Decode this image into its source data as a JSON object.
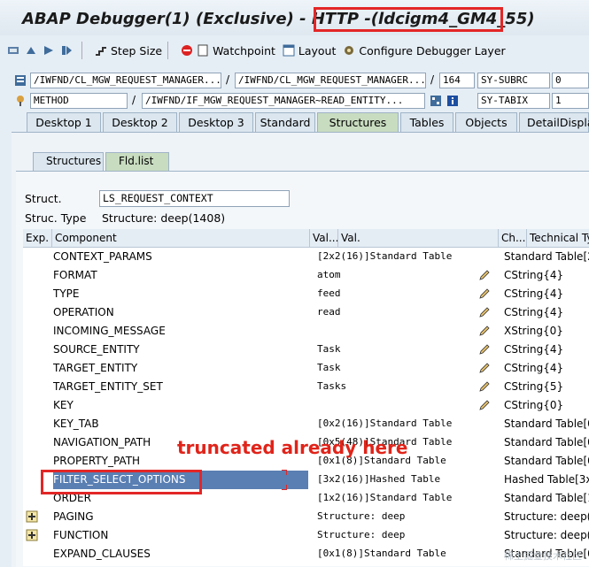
{
  "title": {
    "text": "ABAP Debugger(1)  (Exclusive) - HTTP ",
    "highlight": "-(ldcigm4_GM4_55)"
  },
  "toolbar": {
    "buttons": [
      {
        "label": "",
        "icon": "step-over-icon"
      },
      {
        "label": "",
        "icon": "step-out-icon"
      },
      {
        "label": "",
        "icon": "continue-icon"
      },
      {
        "label": "",
        "icon": "run-to-cursor-icon"
      },
      {
        "label": "Step Size",
        "icon": "step-size-icon"
      },
      {
        "label": "Watchpoint",
        "icon": "watchpoint-icon"
      },
      {
        "label": "Layout",
        "icon": "layout-icon"
      },
      {
        "label": "Configure Debugger Layer",
        "icon": "configure-layer-icon"
      }
    ]
  },
  "info1": {
    "program": "/IWFND/CL_MGW_REQUEST_MANAGER...",
    "include": "/IWFND/CL_MGW_REQUEST_MANAGER...",
    "line": "164",
    "sysvar": "SY-SUBRC",
    "sysval": "0"
  },
  "info2": {
    "type": "METHOD",
    "name": "/IWFND/IF_MGW_REQUEST_MANAGER~READ_ENTITY...",
    "sysvar": "SY-TABIX",
    "sysval": "1"
  },
  "tabs": [
    "Desktop 1",
    "Desktop 2",
    "Desktop 3",
    "Standard",
    "Structures",
    "Tables",
    "Objects",
    "DetailDisplay"
  ],
  "subtabs": [
    "Structures",
    "Fld.list"
  ],
  "struct_label": "Struct.",
  "struct_value": "LS_REQUEST_CONTEXT",
  "struct_type_label": "Struc. Type",
  "struct_type_value": "Structure: deep(1408)",
  "columns": [
    "Exp.",
    "Component",
    "Val...",
    "Val.",
    "Ch...",
    "Technical Type"
  ],
  "rows": [
    {
      "component": "CONTEXT_PARAMS",
      "val": "[2x2(16)]Standard Table",
      "pencil": false,
      "tech": "Standard Table[2"
    },
    {
      "component": "FORMAT",
      "val": "atom",
      "pencil": true,
      "tech": "CString{4}"
    },
    {
      "component": "TYPE",
      "val": "feed",
      "pencil": true,
      "tech": "CString{4}"
    },
    {
      "component": "OPERATION",
      "val": "read",
      "pencil": true,
      "tech": "CString{4}"
    },
    {
      "component": "INCOMING_MESSAGE",
      "val": "",
      "pencil": true,
      "tech": "XString{0}"
    },
    {
      "component": "SOURCE_ENTITY",
      "val": "Task",
      "pencil": true,
      "tech": "CString{4}"
    },
    {
      "component": "TARGET_ENTITY",
      "val": "Task",
      "pencil": true,
      "tech": "CString{4}"
    },
    {
      "component": "TARGET_ENTITY_SET",
      "val": "Tasks",
      "pencil": true,
      "tech": "CString{5}"
    },
    {
      "component": "KEY",
      "val": "",
      "pencil": true,
      "tech": "CString{0}"
    },
    {
      "component": "KEY_TAB",
      "val": "[0x2(16)]Standard Table",
      "pencil": false,
      "tech": "Standard Table[0"
    },
    {
      "component": "NAVIGATION_PATH",
      "val": "[0x5(48)]Standard Table",
      "pencil": false,
      "tech": "Standard Table[0"
    },
    {
      "component": "PROPERTY_PATH",
      "val": "[0x1(8)]Standard Table",
      "pencil": false,
      "tech": "Standard Table[0"
    },
    {
      "component": "FILTER_SELECT_OPTIONS",
      "val": "[3x2(16)]Hashed Table",
      "pencil": false,
      "tech": "Hashed Table[3x2"
    },
    {
      "component": "ORDER",
      "val": "[1x2(16)]Standard Table",
      "pencil": false,
      "tech": "Standard Table[1"
    },
    {
      "component": "PAGING",
      "val": "Structure: deep",
      "pencil": false,
      "tech": "Structure: deep(1",
      "expand": true
    },
    {
      "component": "FUNCTION",
      "val": "Structure: deep",
      "pencil": false,
      "tech": "Structure: deep(3",
      "expand": true
    },
    {
      "component": "EXPAND_CLAUSES",
      "val": "[0x1(8)]Standard Table",
      "pencil": false,
      "tech": "Standard Table[0"
    }
  ],
  "annotation": "truncated already here",
  "watermark": "稀土掘金技术社区",
  "colors": {
    "highlight": "#e32626",
    "annotation": "#e0241a",
    "selection": "#5a7fb3"
  }
}
